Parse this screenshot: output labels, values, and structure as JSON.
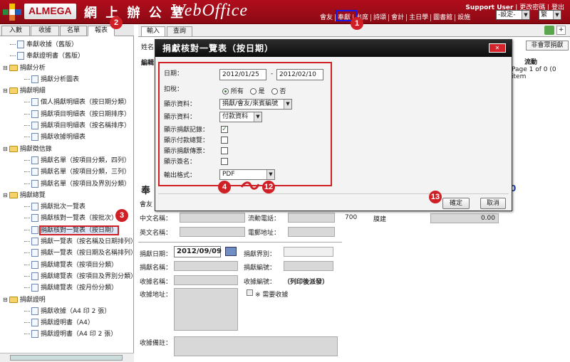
{
  "header": {
    "brand": "ALMEGA",
    "brand_cn": "網 上 辦 公 室",
    "brand_web": "WebOffice",
    "support_user": "Support User",
    "links": [
      "更改密碼",
      "登出"
    ],
    "menu": [
      "會友",
      "奉獻",
      "出席",
      "詩頌",
      "會計",
      "主日學",
      "圖書館",
      "設施"
    ],
    "settings_select": "-設定-",
    "lang_select": "繁"
  },
  "callouts": [
    "1",
    "2",
    "3",
    "4",
    "12",
    "13"
  ],
  "left_panel": {
    "tabs": [
      "入數",
      "收據",
      "名單",
      "報表"
    ],
    "tree": [
      {
        "label": "奉獻收據（舊版）",
        "level": 0,
        "type": "doc"
      },
      {
        "label": "奉獻證明書（舊版）",
        "level": 0,
        "type": "doc"
      },
      {
        "label": "捐獻分析",
        "level": 0,
        "type": "folder"
      },
      {
        "label": "捐獻分析圖表",
        "level": 1,
        "type": "doc"
      },
      {
        "label": "捐獻明細",
        "level": 0,
        "type": "folder"
      },
      {
        "label": "個人捐獻明細表（按日期分類）",
        "level": 1,
        "type": "doc"
      },
      {
        "label": "捐獻項目明細表（按日期排序）",
        "level": 1,
        "type": "doc"
      },
      {
        "label": "捐獻項目明細表（按名稱排序）",
        "level": 1,
        "type": "doc"
      },
      {
        "label": "捐獻收據明細表",
        "level": 1,
        "type": "doc"
      },
      {
        "label": "捐獻徵信錄",
        "level": 0,
        "type": "folder"
      },
      {
        "label": "捐獻名單（按項目分類，四列）",
        "level": 1,
        "type": "doc"
      },
      {
        "label": "捐獻名單（按項目分類，三列）",
        "level": 1,
        "type": "doc"
      },
      {
        "label": "捐獻名單（按項目及界別分類）",
        "level": 1,
        "type": "doc"
      },
      {
        "label": "捐獻總覽",
        "level": 0,
        "type": "folder"
      },
      {
        "label": "捐獻批次一覽表",
        "level": 1,
        "type": "doc"
      },
      {
        "label": "捐獻核對一覽表（按批次）",
        "level": 1,
        "type": "doc"
      },
      {
        "label": "捐獻核對一覽表（按日期）",
        "level": 1,
        "type": "doc",
        "selected": true
      },
      {
        "label": "捐獻一覽表（按名稱及日期排列）",
        "level": 1,
        "type": "doc"
      },
      {
        "label": "捐獻一覽表（按日期及名稱排列）",
        "level": 1,
        "type": "doc"
      },
      {
        "label": "捐獻總覽表（按項目分類）",
        "level": 1,
        "type": "doc"
      },
      {
        "label": "捐獻總覽表（按項目及界別分類）",
        "level": 1,
        "type": "doc"
      },
      {
        "label": "捐獻總覽表（按月份分類）",
        "level": 1,
        "type": "doc"
      },
      {
        "label": "捐獻證明",
        "level": 0,
        "type": "folder"
      },
      {
        "label": "捐獻收據（A4 印 2 張）",
        "level": 1,
        "type": "doc"
      },
      {
        "label": "捐獻證明書（A4）",
        "level": 1,
        "type": "doc"
      },
      {
        "label": "捐獻證明書（A4 印 2 張）",
        "level": 1,
        "type": "doc"
      }
    ]
  },
  "main": {
    "tabs": [
      "輸入",
      "查詢"
    ],
    "bg": {
      "name_label": "姓名",
      "edit_label": "編輯",
      "nonmember_btn": "非會眾捐獻",
      "page_info": "Page 1 of 0 (0 item",
      "col_flow": "流動",
      "dedication_label": "奉",
      "member_label": "會友",
      "cn_name_label": "中文名稱：",
      "mobile_label": "流動電話：",
      "en_name_label": "英文名稱：",
      "email_label": "電郵地址：",
      "row_code": "700",
      "row_name": "膜建",
      "row_amount": "0.00",
      "big_zero": "0",
      "donation_date_label": "捐獻日期：",
      "donation_date": "2012/09/09",
      "sector_label": "捐獻界別：",
      "donor_name_label": "捐獻名稱：",
      "donor_no_label": "捐獻編號：",
      "receipt_name_label": "收據名稱：",
      "receipt_no_label": "收據編號：",
      "receipt_no_value": "（列印後派發）",
      "receipt_addr_label": "收據地址：",
      "need_receipt_label": "※ 需要收據",
      "receipt_note_label": "收據備註："
    }
  },
  "dialog": {
    "title": "捐獻核對一覽表（按日期）",
    "close_label": "×關閉",
    "date_label": "日期：",
    "date_from": "2012/01/25",
    "date_sep": "-",
    "date_to": "2012/02/10",
    "tax_label": "扣稅：",
    "tax_options": [
      "所有",
      "是",
      "否"
    ],
    "display_data_label": "顯示資料：",
    "display_data_value": "捐獻/會友/來賓編號",
    "display_data2_label": "顯示資料：",
    "display_data2_value": "付款資料",
    "show_records_label": "顯示捐獻記錄：",
    "show_payment_label": "顯示付款總覽：",
    "show_receipt_label": "顯示捐獻傳票：",
    "show_sign_label": "顯示簽名：",
    "output_label": "輸出格式：",
    "output_value": "PDF",
    "confirm": "確定",
    "cancel": "取消"
  }
}
